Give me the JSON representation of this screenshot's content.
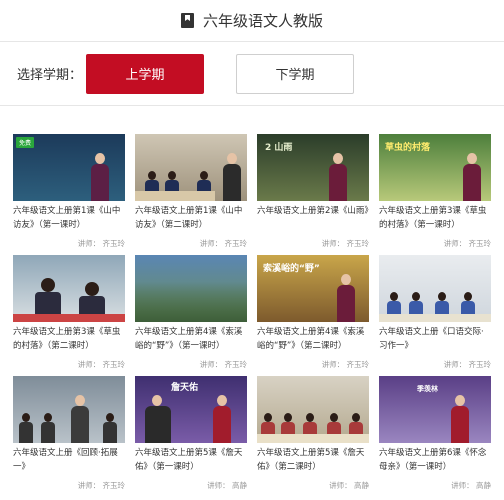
{
  "header": {
    "title": "六年级语文人教版",
    "icon": "book-icon"
  },
  "term": {
    "label": "选择学期：",
    "first": "上学期",
    "second": "下学期",
    "active_color": "#c30d23"
  },
  "videos": [
    {
      "caption": "六年级语文上册第1课《山中访友》（第一课时）",
      "lecturer": "讲师： 齐玉玲",
      "tag": "免费"
    },
    {
      "caption": "六年级语文上册第1课《山中访友》（第二课时）",
      "lecturer": "讲师： 齐玉玲"
    },
    {
      "caption": "六年级语文上册第2课《山雨》",
      "lecturer": "讲师： 齐玉玲"
    },
    {
      "caption": "六年级语文上册第3课《草虫的村落》（第一课时）",
      "lecturer": "讲师： 齐玉玲"
    },
    {
      "caption": "六年级语文上册第3课《草虫的村落》（第二课时）",
      "lecturer": "讲师： 齐玉玲"
    },
    {
      "caption": "六年级语文上册第4课《索溪峪的“野”》（第一课时）",
      "lecturer": "讲师： 齐玉玲"
    },
    {
      "caption": "六年级语文上册第4课《索溪峪的“野”》（第二课时）",
      "lecturer": "讲师： 齐玉玲"
    },
    {
      "caption": "六年级语文上册《口语交际·习作一》",
      "lecturer": "讲师： 齐玉玲"
    },
    {
      "caption": "六年级语文上册《回顾·拓展一》",
      "lecturer": "讲师： 齐玉玲"
    },
    {
      "caption": "六年级语文上册第5课《詹天佑》（第一课时）",
      "lecturer": "讲师： 高静"
    },
    {
      "caption": "六年级语文上册第5课《詹天佑》（第二课时）",
      "lecturer": "讲师： 高静"
    },
    {
      "caption": "六年级语文上册第6课《怀念母亲》（第一课时）",
      "lecturer": "讲师： 高静"
    }
  ],
  "thumb_text": {
    "t3": "2 山雨",
    "t4": "草虫的村落",
    "t7": "索溪峪的“野”",
    "t10": "詹天佑",
    "t12": "季羡林"
  }
}
